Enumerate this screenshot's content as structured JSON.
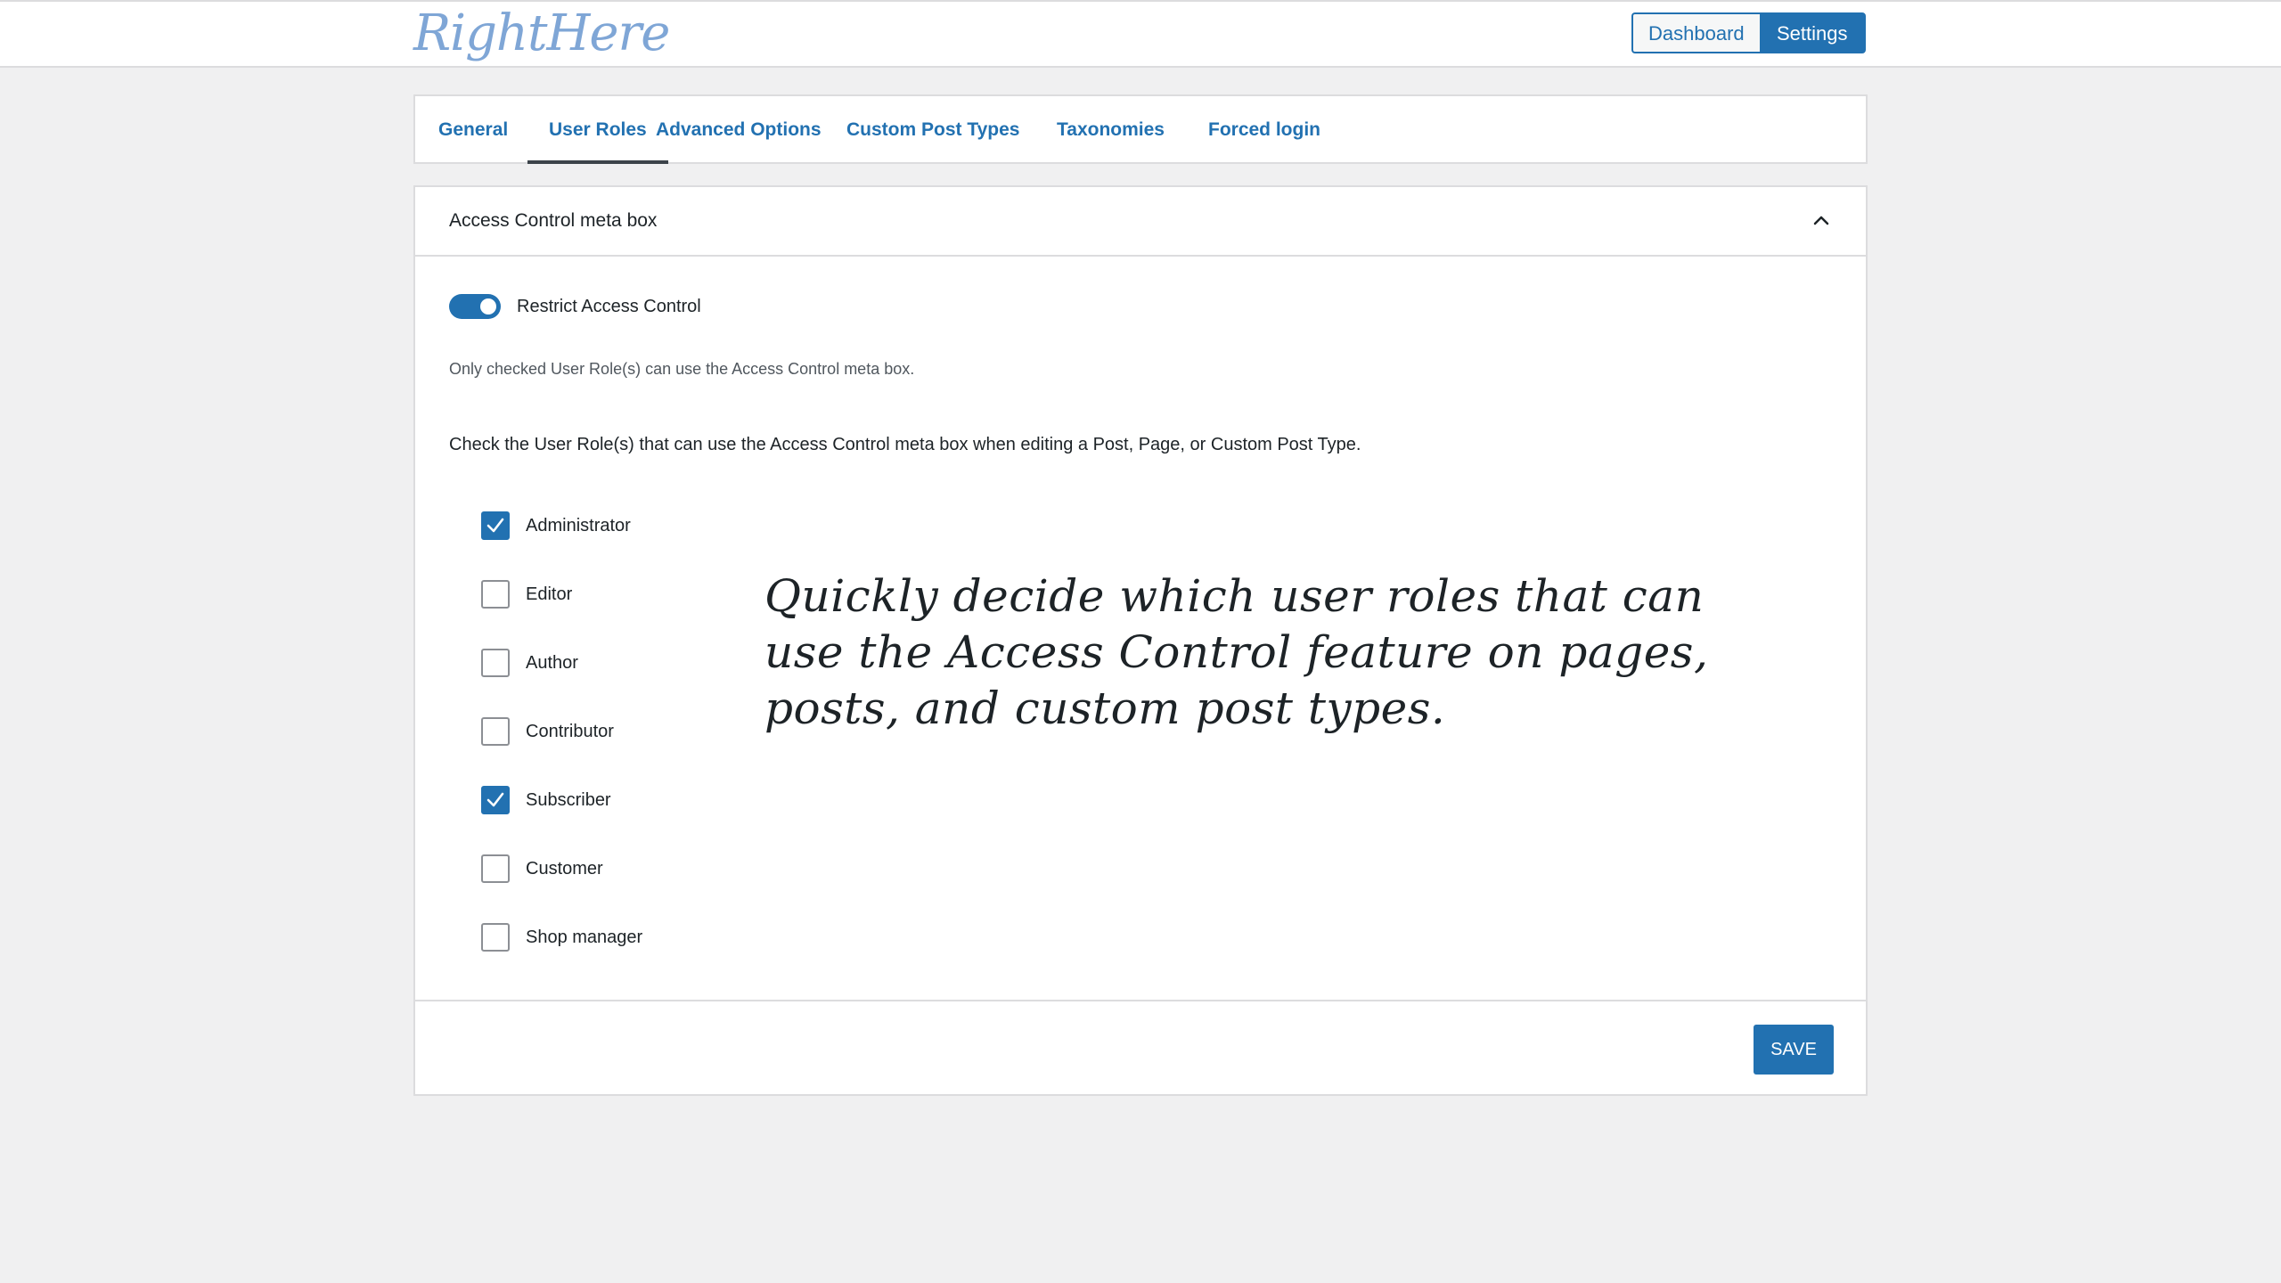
{
  "header": {
    "logo_text": "RightHere",
    "nav": {
      "dashboard_label": "Dashboard",
      "settings_label": "Settings",
      "active": "Settings"
    }
  },
  "tabs": [
    {
      "label": "General",
      "active": false
    },
    {
      "label": "User Roles",
      "active": true
    },
    {
      "label": "Advanced Options",
      "active": false
    },
    {
      "label": "Custom Post Types",
      "active": false
    },
    {
      "label": "Taxonomies",
      "active": false
    },
    {
      "label": "Forced login",
      "active": false
    }
  ],
  "panel": {
    "title": "Access Control meta box",
    "toggle": {
      "label": "Restrict Access Control",
      "enabled": true
    },
    "help_text": "Only checked User Role(s) can use the Access Control meta box.",
    "instruction": "Check the User Role(s) that can use the Access Control meta box when editing a Post, Page, or Custom Post Type.",
    "roles": [
      {
        "label": "Administrator",
        "checked": true
      },
      {
        "label": "Editor",
        "checked": false
      },
      {
        "label": "Author",
        "checked": false
      },
      {
        "label": "Contributor",
        "checked": false
      },
      {
        "label": "Subscriber",
        "checked": true
      },
      {
        "label": "Customer",
        "checked": false
      },
      {
        "label": "Shop manager",
        "checked": false
      }
    ],
    "save_label": "SAVE"
  },
  "annotation": "Quickly decide which user roles that can use the Access Control feature on pages, posts, and custom post types.",
  "colors": {
    "accent": "#2271b1",
    "logo": "#7fa6d6",
    "background": "#f0f0f1"
  }
}
